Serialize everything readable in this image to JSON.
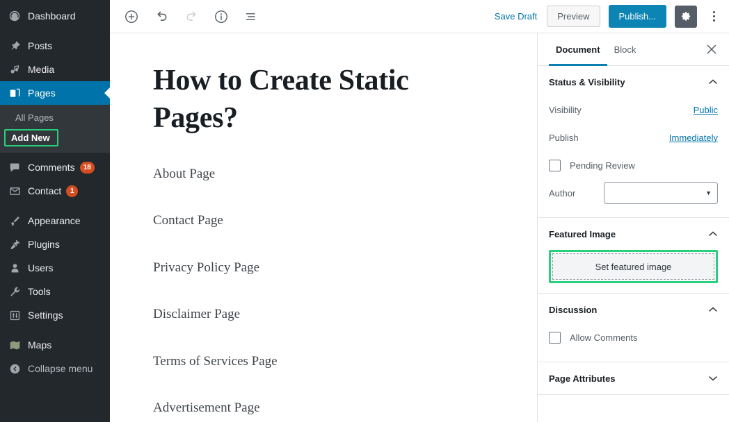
{
  "sidebar": {
    "items": [
      {
        "label": "Dashboard",
        "icon": "dashboard-icon",
        "current": false,
        "gap_after": true
      },
      {
        "label": "Posts",
        "icon": "pin-icon",
        "current": false,
        "gap_after": false
      },
      {
        "label": "Media",
        "icon": "media-icon",
        "current": false,
        "gap_after": false
      },
      {
        "label": "Pages",
        "icon": "pages-icon",
        "current": true,
        "gap_after": false
      }
    ],
    "submenu": [
      {
        "label": "All Pages",
        "highlighted": false
      },
      {
        "label": "Add New",
        "highlighted": true
      }
    ],
    "items2": [
      {
        "label": "Comments",
        "icon": "comment-icon",
        "badge": "18"
      },
      {
        "label": "Contact",
        "icon": "mail-icon",
        "badge": "1"
      }
    ],
    "items3": [
      {
        "label": "Appearance",
        "icon": "brush-icon"
      },
      {
        "label": "Plugins",
        "icon": "plug-icon"
      },
      {
        "label": "Users",
        "icon": "user-icon"
      },
      {
        "label": "Tools",
        "icon": "wrench-icon"
      },
      {
        "label": "Settings",
        "icon": "sliders-icon"
      }
    ],
    "items4": [
      {
        "label": "Maps",
        "icon": "maps-icon"
      }
    ],
    "collapse": {
      "label": "Collapse menu",
      "icon": "collapse-arrow-icon"
    },
    "highlight_color": "#26d07c",
    "current_color": "#0073aa",
    "badge_color": "#d54e21"
  },
  "toolbar": {
    "add_block_label": "add-block",
    "undo_label": "undo",
    "redo_label": "redo",
    "info_label": "content-structure",
    "outline_label": "block-navigation",
    "save_draft_label": "Save Draft",
    "preview_label": "Preview",
    "publish_label": "Publish...",
    "settings_label": "settings",
    "more_label": "more-options",
    "publish_color": "#0c84b4"
  },
  "editor": {
    "title": "How to Create Static Pages?",
    "paragraphs": [
      "About Page",
      "Contact Page",
      "Privacy Policy Page",
      "Disclaimer Page",
      "Terms of Services Page",
      "Advertisement Page"
    ]
  },
  "settings_panel": {
    "tabs": [
      {
        "label": "Document",
        "selected": true
      },
      {
        "label": "Block",
        "selected": false
      }
    ],
    "close_label": "×",
    "status": {
      "heading": "Status & Visibility",
      "visibility_label": "Visibility",
      "visibility_value": "Public",
      "publish_label": "Publish",
      "publish_value": "Immediately",
      "pending_review_label": "Pending Review",
      "pending_review_checked": false,
      "author_label": "Author",
      "author_value": ""
    },
    "featured_image": {
      "heading": "Featured Image",
      "button_label": "Set featured image",
      "highlight_color": "#26d07c"
    },
    "discussion": {
      "heading": "Discussion",
      "allow_comments_label": "Allow Comments",
      "allow_comments_checked": false
    },
    "page_attributes": {
      "heading": "Page Attributes",
      "expanded": false
    },
    "accent_color": "#0c7fb0",
    "link_color": "#0073aa"
  }
}
